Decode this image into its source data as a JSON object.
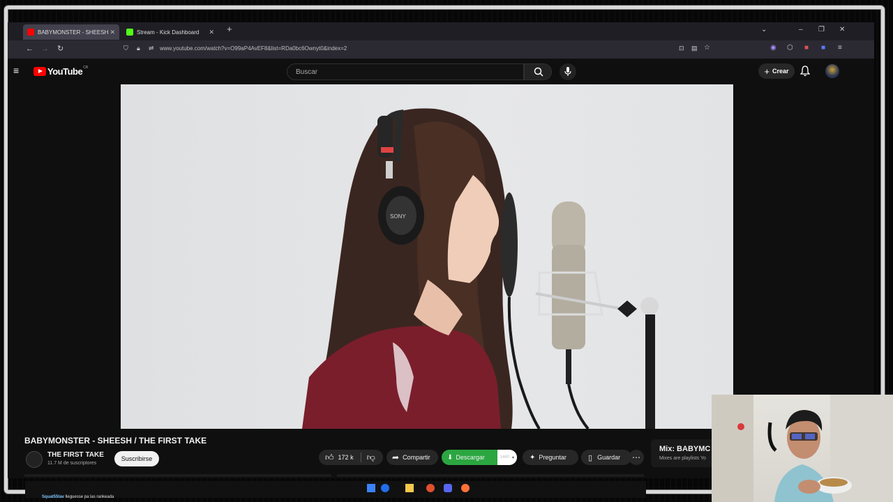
{
  "browser": {
    "tabs": [
      {
        "label": "BABYMONSTER - SHEESH /",
        "active": true,
        "icon": "youtube-favicon"
      },
      {
        "label": "Stream - Kick Dashboard",
        "active": false,
        "icon": "kick-favicon"
      }
    ],
    "url": "www.youtube.com/watch?v=O99aP4AvEF8&list=RDa0bc6Ownyt0&index=2"
  },
  "youtube": {
    "logo_text": "YouTube",
    "country_code": "CR",
    "search_placeholder": "Buscar",
    "create_label": "Crear",
    "video": {
      "title": "BABYMONSTER - SHEESH / THE FIRST TAKE",
      "channel_name": "THE FIRST TAKE",
      "subscribers": "11.7 M de suscriptores",
      "subscribe_label": "Suscribirse",
      "likes": "172 k",
      "share_label": "Compartir",
      "download_label": "Descargar",
      "download_quality": "1440",
      "ask_label": "Preguntar",
      "save_label": "Guardar"
    },
    "mix": {
      "title": "Mix: BABYMC",
      "subtitle": "Mixes are playlists Yo"
    }
  },
  "stream_chat": {
    "user": "Squat55tav",
    "message": "lleguesse pa las rankeada"
  },
  "colors": {
    "yt_red": "#ff0000",
    "download_green": "#2ba640",
    "bg": "#0f0f0f"
  }
}
